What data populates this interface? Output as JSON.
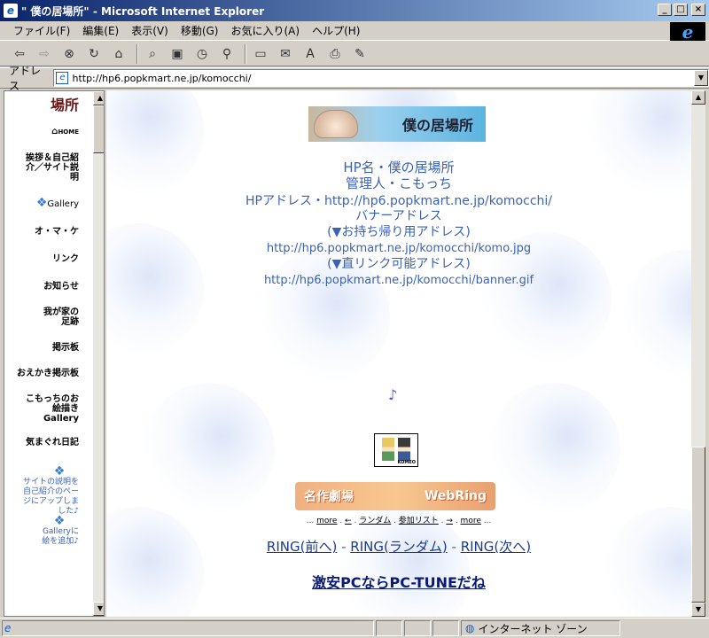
{
  "window": {
    "title": "\" 僕の居場所\" - Microsoft Internet Explorer",
    "min": "_",
    "max": "□",
    "close": "×"
  },
  "menu": [
    "ファイル(F)",
    "編集(E)",
    "表示(V)",
    "移動(G)",
    "お気に入り(A)",
    "ヘルプ(H)"
  ],
  "address": {
    "label": "アドレス",
    "url": "http://hp6.popkmart.ne.jp/komocchi/"
  },
  "sidebar": {
    "title": "場所",
    "items": [
      "HOME",
      "挨拶＆自己紹介／サイト説明",
      "Gallery",
      "オ・マ・ケ",
      "リンク",
      "お知らせ",
      "我が家の足跡",
      "掲示板",
      "おえかき掲示板",
      "こもっちのお絵描きGallery",
      "気まぐれ日記"
    ],
    "note1": "サイトの説明を自己紹介のページにアップしました♪",
    "note2": "Galleryに絵を追加♪"
  },
  "main": {
    "banner_text": "僕の居場所",
    "lines": [
      "HP名・僕の居場所",
      "管理人・こもっち",
      "HPアドレス・http://hp6.popkmart.ne.jp/komocchi/",
      "バナーアドレス",
      "(▼お持ち帰り用アドレス)",
      "http://hp6.popkmart.ne.jp/komocchi/komo.jpg",
      "(▼直リンク可能アドレス)",
      "http://hp6.popkmart.ne.jp/komocchi/banner.gif"
    ],
    "music_note": "♪",
    "link_icon_label": "KOMEO",
    "ring_banner_left": "名作劇場",
    "ring_banner_right": "WebRing",
    "ring_nav": {
      "more1": "more",
      "prev": "←",
      "random": "ランダム",
      "list": "参加リスト",
      "next": "→",
      "more2": "more"
    },
    "ring_links": {
      "prev": "RING(前へ)",
      "random": "RING(ランダム)",
      "next": "RING(次へ)",
      "sep": "-"
    },
    "pctune": "激安PCならPC-TUNEだね"
  },
  "status": {
    "zone": "インターネット ゾーン"
  }
}
